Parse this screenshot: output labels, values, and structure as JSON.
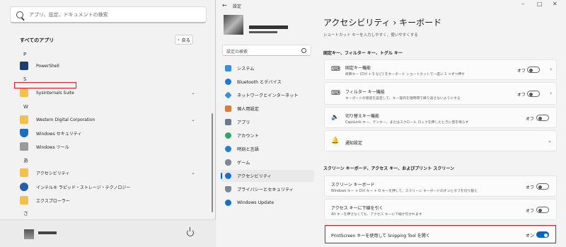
{
  "start_menu": {
    "search_placeholder": "アプリ、設定、ドキュメントの検索",
    "all_apps_title": "すべてのアプリ",
    "back_label": "戻る",
    "letters": {
      "p": "P",
      "s": "S",
      "w": "W",
      "a": "あ",
      "sa": "さ"
    },
    "apps": {
      "powershell": "PowerShell",
      "sysinternals": "Sysinternals Suite",
      "wdc": "Western Digital Corporation",
      "winsec": "Windows セキュリティ",
      "wintools": "Windows ツール",
      "accessibility": "アクセシビリティ",
      "intel": "インテル® ラピッド・ストレージ・テクノロジー",
      "explorer": "エクスプローラー"
    }
  },
  "settings": {
    "title": "設定",
    "search_placeholder": "設定の検索",
    "nav": [
      "システム",
      "Bluetooth とデバイス",
      "ネットワークとインターネット",
      "個人用設定",
      "アプリ",
      "アカウント",
      "時刻と言語",
      "ゲーム",
      "アクセシビリティ",
      "プライバシーとセキュリティ",
      "Windows Update"
    ],
    "page_title": "アクセシビリティ  ›  キーボード",
    "page_subtitle": "ショートカット キーを入力しやすく、使いやすくする",
    "section1": "固定キー、フィルター キー、トグル キー",
    "section2": "スクリーン キーボード、アクセス キー、およびプリント スクリーン",
    "sticky": {
      "title": "固定キー機能",
      "desc": "修飾キー (Ctrl + S など) をキーボード ショートカットで一度に 1 つずつ押す",
      "state": "オフ"
    },
    "filter": {
      "title": "フィルター キー機能",
      "desc": "キーボードの感度を設定して、キー操作を短時間で繰り返さないようにする",
      "state": "オフ"
    },
    "toggle_keys": {
      "title": "切り替えキー機能",
      "desc": "CapsLock キー、テンキー、またはスクロール ロックを押したときに音を鳴らす",
      "state": "オフ"
    },
    "notify": {
      "title": "通知設定"
    },
    "osk": {
      "title": "スクリーン キーボード",
      "desc": "Windows キー + Ctrl キー + O キーを押して、スクリーン キーボードのオンとオフを切り替え",
      "state": "オフ"
    },
    "underline": {
      "title": "アクセス キーに下線を引く",
      "desc": "Alt キーを押さなくても、アクセス キーに下線が引かれます",
      "state": "オフ"
    },
    "printscreen": {
      "title": "PrintScreen キーを使用して Snipping Tool を開く",
      "state": "オン"
    }
  }
}
